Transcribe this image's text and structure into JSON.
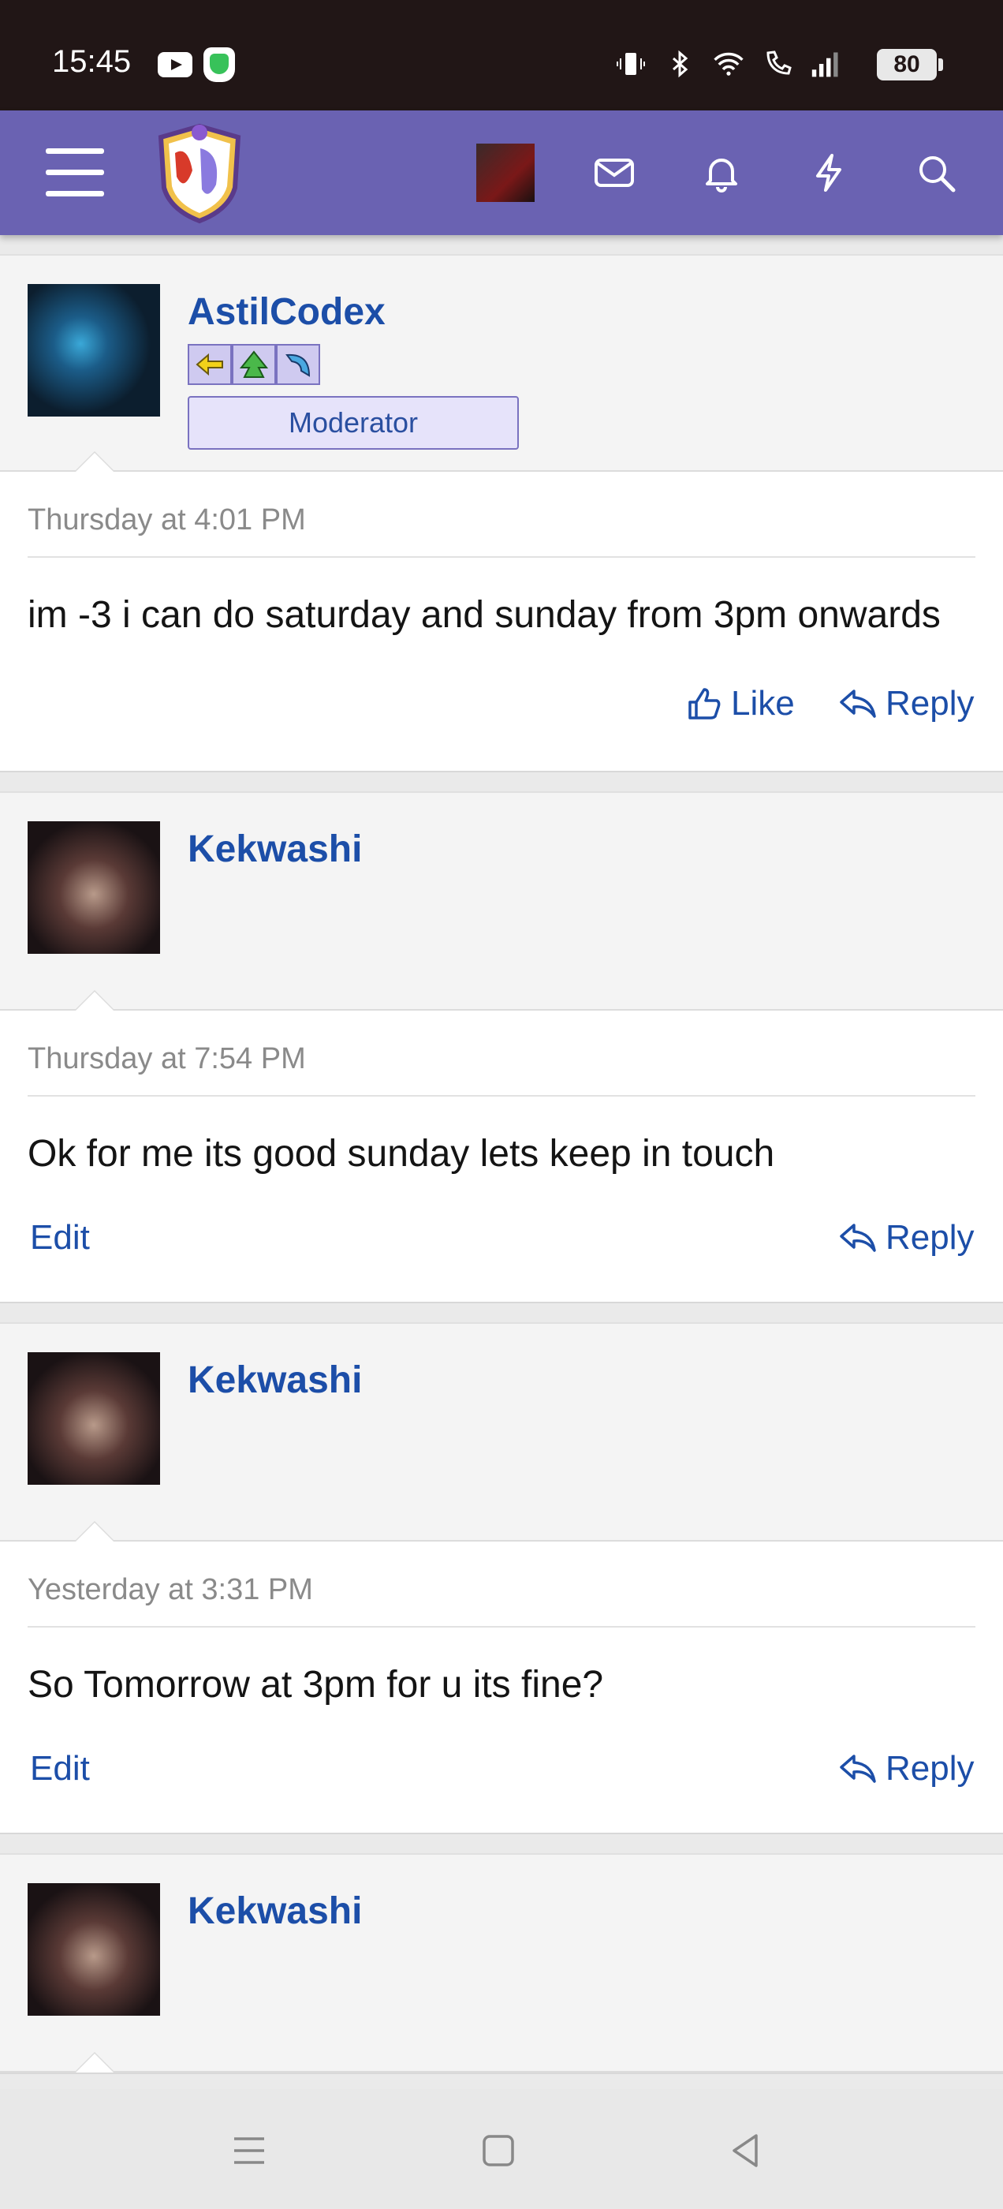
{
  "status_bar": {
    "time": "15:45",
    "battery": "80"
  },
  "app": {
    "accent": "#6a62b2",
    "link_color": "#1c4ea8"
  },
  "posts": [
    {
      "username": "AstilCodex",
      "role": "Moderator",
      "date": "Thursday at 4:01 PM",
      "text": "im -3 i can do saturday and sunday from 3pm onwards",
      "actions": {
        "like": "Like",
        "reply": "Reply"
      }
    },
    {
      "username": "Kekwashi",
      "date": "Thursday at 7:54 PM",
      "text": "Ok for me its good sunday lets keep in touch",
      "actions": {
        "edit": "Edit",
        "reply": "Reply"
      }
    },
    {
      "username": "Kekwashi",
      "date": "Yesterday at 3:31 PM",
      "text": "So Tomorrow at 3pm for u its fine?",
      "actions": {
        "edit": "Edit",
        "reply": "Reply"
      }
    },
    {
      "username": "Kekwashi"
    }
  ]
}
